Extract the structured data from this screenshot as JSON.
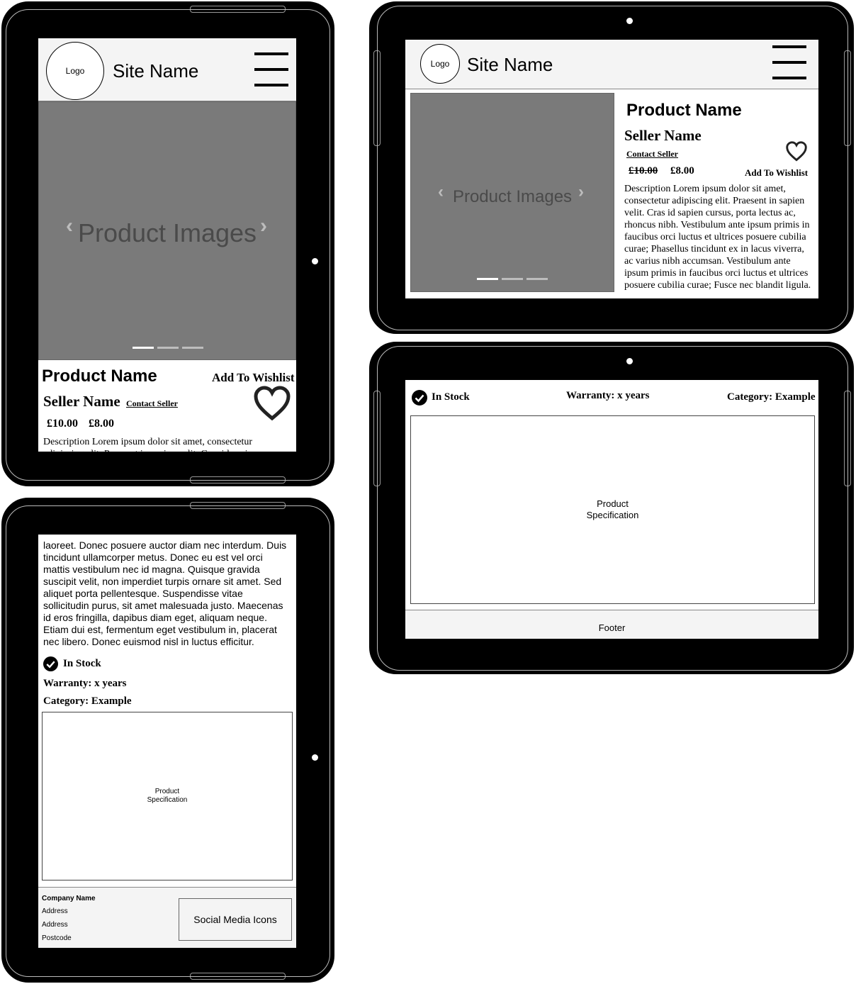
{
  "site": {
    "logo": "Logo",
    "name": "Site Name"
  },
  "carousel": {
    "label": "Product Images",
    "prev": "‹",
    "next": "›"
  },
  "product": {
    "name": "Product Name",
    "seller": "Seller Name",
    "contact": "Contact Seller",
    "wishlist": "Add To Wishlist",
    "old_price": "£10.00",
    "price": "£8.00",
    "desc_portrait": "Description Lorem ipsum dolor sit amet, consectetur adipiscing elit. Praesent in sapien velit. Cras id sapien",
    "desc_landscape": "Description Lorem ipsum dolor sit amet, consectetur adipiscing elit. Praesent in sapien velit. Cras id sapien cursus, porta lectus ac, rhoncus nibh. Vestibulum ante ipsum primis in faucibus orci luctus et ultrices posuere cubilia curae; Phasellus tincidunt ex in lacus viverra, ac varius nibh accumsan. Vestibulum ante ipsum primis in faucibus orci luctus et ultrices posuere cubilia curae; Fusce nec blandit ligula.",
    "desc_continued": "laoreet. Donec posuere auctor diam nec interdum. Duis tincidunt ullamcorper metus. Donec eu est vel orci mattis vestibulum nec id magna. Quisque gravida suscipit velit, non imperdiet turpis ornare sit amet. Sed aliquet porta pellentesque. Suspendisse vitae sollicitudin purus, sit amet malesuada justo. Maecenas id eros fringilla, dapibus diam eget, aliquam neque. Etiam dui est, fermentum eget vestibulum in, placerat nec libero. Donec euismod nisl in luctus efficitur."
  },
  "meta": {
    "stock": "In Stock",
    "warranty": "Warranty: x years",
    "category": "Category: Example"
  },
  "spec": {
    "line1": "Product",
    "line2": "Specification"
  },
  "footer": {
    "label": "Footer",
    "company": "Company Name",
    "address1": "Address",
    "address2": "Address",
    "postcode": "Postcode",
    "social": "Social Media Icons"
  },
  "colors": {
    "header_bg": "#f4f4f4",
    "carousel_bg": "#7a7a7a",
    "device": "#000000"
  }
}
